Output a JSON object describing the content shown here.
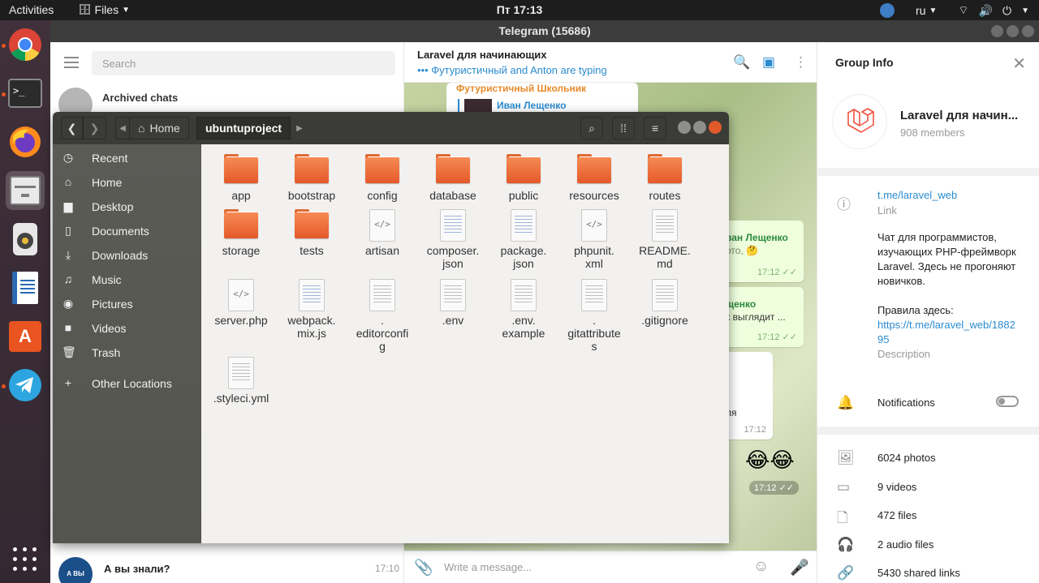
{
  "topbar": {
    "activities": "Activities",
    "app_menu": "Files",
    "clock": "Пт 17:13",
    "language": "ru"
  },
  "dock": {
    "items": [
      "chrome",
      "terminal",
      "firefox",
      "files",
      "rhythmbox",
      "writer",
      "software",
      "telegram"
    ]
  },
  "telegram": {
    "window_title": "Telegram (15686)",
    "search_placeholder": "Search",
    "archived_label": "Archived chats",
    "last_chat": {
      "name": "А вы знали?",
      "time": "17:10",
      "avatar_text": "А ВЫ ЗНАЛИ"
    },
    "chat": {
      "title": "Laravel для начинающих",
      "typing": "••• Футуристичный and Anton are typing",
      "top_author": "Футуристичный Школьник",
      "top_reply_name": "Иван Лещенко",
      "msg1_name": "ван Лещенко",
      "msg1_text": "ото, 🤔",
      "msg1_time": "17:12",
      "msg2_name": "щенко",
      "msg2_text": "к выглядит ...",
      "msg2_time": "17:12",
      "msg3_text": "ля",
      "msg3_time": "17:12",
      "emoji": "😂😂",
      "emoji_time": "17:12",
      "composer_placeholder": "Write a message..."
    },
    "group_info": {
      "heading": "Group Info",
      "name": "Laravel для начин...",
      "members": "908 members",
      "link": "t.me/laravel_web",
      "link_label": "Link",
      "description_lines": [
        "Чат для программистов,",
        "изучающих PHP-фреймворк",
        "Laravel. Здесь не прогоняют",
        "новичков."
      ],
      "rules_prefix": "Правила здесь:",
      "rules_link_1": "https://t.me/laravel_web/1882",
      "rules_link_2": "95",
      "description_label": "Description",
      "notifications": "Notifications",
      "media": {
        "photos": "6024 photos",
        "videos": "9 videos",
        "files": "472 files",
        "audio": "2 audio files",
        "links": "5430 shared links"
      }
    }
  },
  "files": {
    "breadcrumb_home": "Home",
    "breadcrumb_current": "ubuntuproject",
    "sidebar": [
      {
        "icon": "clock-icon",
        "label": "Recent"
      },
      {
        "icon": "home-icon",
        "label": "Home"
      },
      {
        "icon": "folder-icon",
        "label": "Desktop"
      },
      {
        "icon": "document-icon",
        "label": "Documents"
      },
      {
        "icon": "download-icon",
        "label": "Downloads"
      },
      {
        "icon": "music-icon",
        "label": "Music"
      },
      {
        "icon": "camera-icon",
        "label": "Pictures"
      },
      {
        "icon": "video-icon",
        "label": "Videos"
      },
      {
        "icon": "trash-icon",
        "label": "Trash"
      },
      {
        "icon": "plus-icon",
        "label": "Other Locations"
      }
    ],
    "items": [
      {
        "name": "app",
        "kind": "folder"
      },
      {
        "name": "bootstrap",
        "kind": "folder"
      },
      {
        "name": "config",
        "kind": "folder"
      },
      {
        "name": "database",
        "kind": "folder"
      },
      {
        "name": "public",
        "kind": "folder"
      },
      {
        "name": "resources",
        "kind": "folder"
      },
      {
        "name": "routes",
        "kind": "folder"
      },
      {
        "name": "storage",
        "kind": "folder"
      },
      {
        "name": "tests",
        "kind": "folder"
      },
      {
        "name": "artisan",
        "kind": "code"
      },
      {
        "name": "composer.\njson",
        "kind": "text-color"
      },
      {
        "name": "package.\njson",
        "kind": "text-color"
      },
      {
        "name": "phpunit.\nxml",
        "kind": "code"
      },
      {
        "name": "README.\nmd",
        "kind": "text"
      },
      {
        "name": "server.php",
        "kind": "code"
      },
      {
        "name": "webpack.\nmix.js",
        "kind": "text-color"
      },
      {
        "name": ".\neditorconfi\ng",
        "kind": "text"
      },
      {
        "name": ".env",
        "kind": "text"
      },
      {
        "name": ".env.\nexample",
        "kind": "text"
      },
      {
        "name": ".\ngitattribute\ns",
        "kind": "text"
      },
      {
        "name": ".gitignore",
        "kind": "text"
      },
      {
        "name": ".styleci.yml",
        "kind": "text"
      }
    ]
  }
}
